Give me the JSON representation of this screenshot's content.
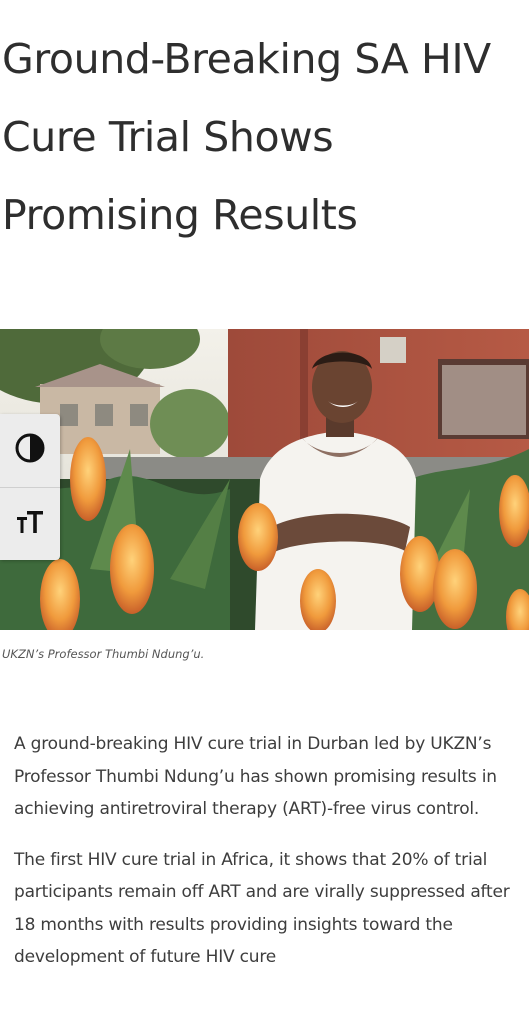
{
  "article": {
    "title": "Ground-Breaking SA HIV Cure Trial Shows Promising Results",
    "image_caption": "UKZN’s Professor Thumbi Ndung’u.",
    "paragraphs": [
      "A ground-breaking HIV cure trial in Durban led by UKZN’s Professor Thumbi Ndung’u has shown promising results in achieving antiretroviral therapy (ART)-free virus control.",
      "The first HIV cure trial in Africa, it shows that 20% of trial participants remain off ART and are virally suppressed after 18 months with results providing insights toward the development of future HIV cure"
    ]
  },
  "accessibility_toolbar": {
    "contrast_icon": "contrast-icon",
    "text_size_icon": "text-size-icon"
  },
  "colors": {
    "text": "#2e2e2e",
    "toolbar_bg": "#ececec"
  }
}
